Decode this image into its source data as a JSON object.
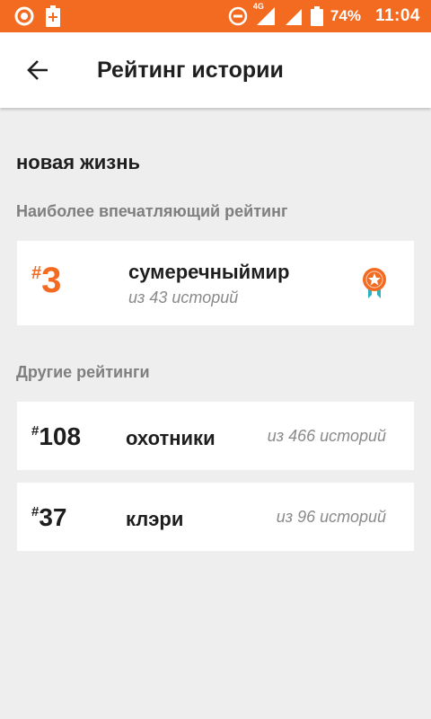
{
  "status_bar": {
    "network": "4G",
    "battery": "74%",
    "time": "11:04"
  },
  "app_bar": {
    "title": "Рейтинг истории"
  },
  "story": {
    "title": "новая жизнь"
  },
  "top_ranking": {
    "section_label": "Наиболее впечатляющий рейтинг",
    "hash": "#",
    "rank": "3",
    "tag": "сумеречныймир",
    "of_text": "из 43 историй",
    "icon": "award-medal-icon"
  },
  "other_rankings": {
    "section_label": "Другие рейтинги",
    "items": [
      {
        "hash": "#",
        "rank": "108",
        "tag": "охотники",
        "of_text": "из 466 историй"
      },
      {
        "hash": "#",
        "rank": "37",
        "tag": "клэри",
        "of_text": "из 96 историй"
      }
    ]
  },
  "colors": {
    "accent": "#f36b21",
    "badge_ribbon": "#2ab3c4",
    "background": "#efeeee"
  }
}
